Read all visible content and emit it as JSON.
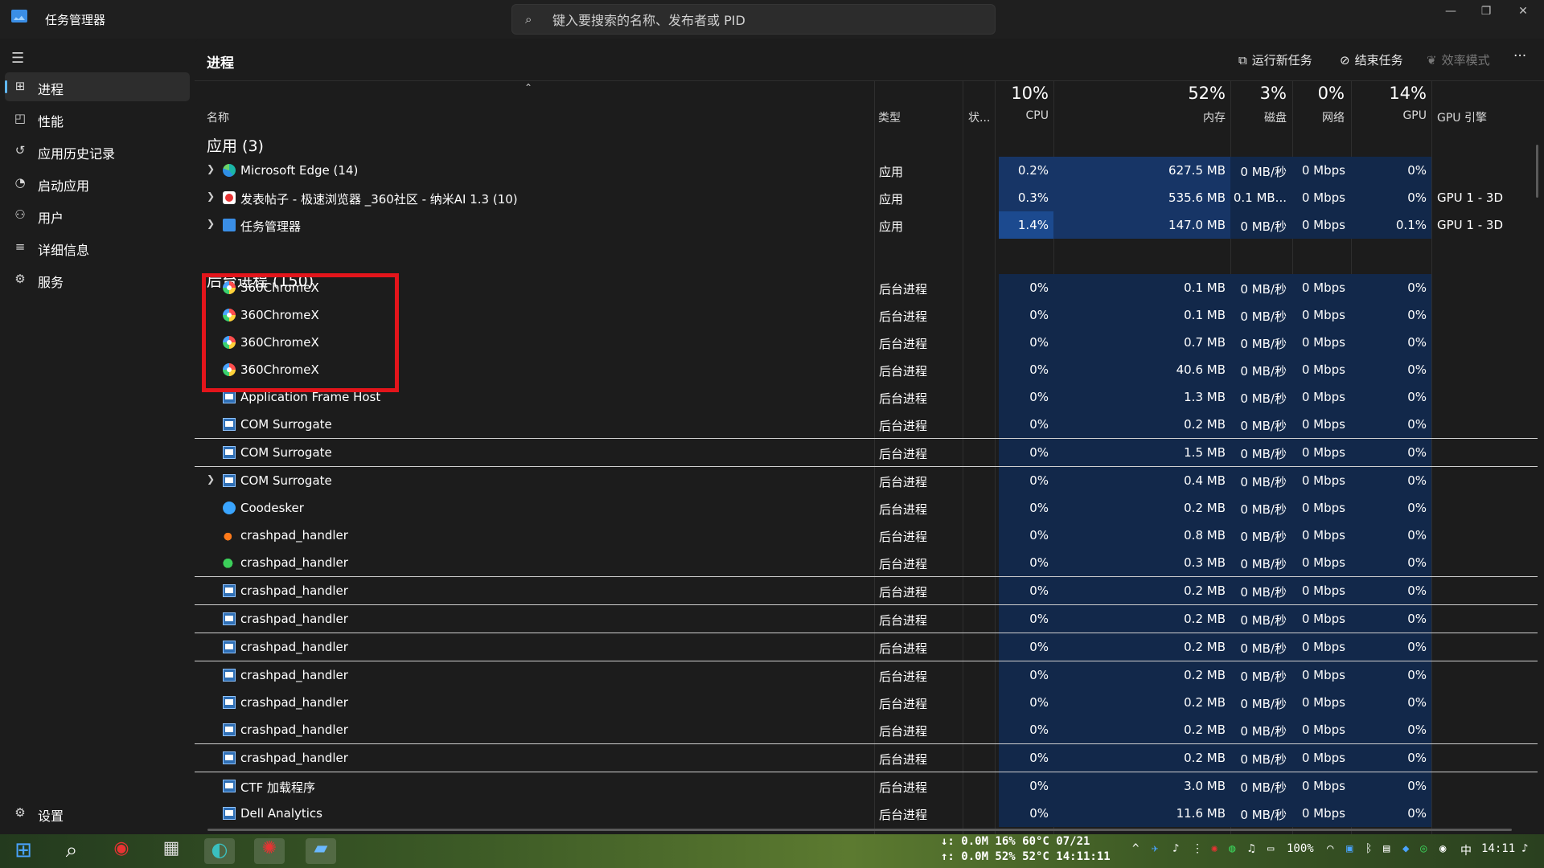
{
  "window": {
    "title": "任务管理器",
    "controls": [
      "—",
      "❐",
      "✕"
    ]
  },
  "search": {
    "placeholder": "键入要搜索的名称、发布者或 PID"
  },
  "sidebar": {
    "items": [
      {
        "label": "进程",
        "icon": "processes-icon",
        "active": true
      },
      {
        "label": "性能",
        "icon": "performance-icon"
      },
      {
        "label": "应用历史记录",
        "icon": "app-history-icon"
      },
      {
        "label": "启动应用",
        "icon": "startup-apps-icon"
      },
      {
        "label": "用户",
        "icon": "users-icon"
      },
      {
        "label": "详细信息",
        "icon": "details-icon"
      },
      {
        "label": "服务",
        "icon": "services-icon"
      }
    ],
    "settings": "设置"
  },
  "toolbar": {
    "page_title": "进程",
    "run_new_task": "运行新任务",
    "end_task": "结束任务",
    "efficiency_mode": "效率模式",
    "more": "···"
  },
  "header": {
    "name": "名称",
    "type": "类型",
    "status": "状...",
    "cpu_pct": "10%",
    "cpu": "CPU",
    "mem_pct": "52%",
    "mem": "内存",
    "disk_pct": "3%",
    "disk": "磁盘",
    "net_pct": "0%",
    "net": "网络",
    "gpu_pct": "14%",
    "gpu": "GPU",
    "gpu_engine": "GPU 引擎"
  },
  "groups": {
    "apps": "应用 (3)",
    "background": "后台进程 (150)"
  },
  "apps": [
    {
      "name": "Microsoft Edge (14)",
      "type": "应用",
      "cpu": "0.2%",
      "mem": "627.5 MB",
      "disk": "0 MB/秒",
      "net": "0 Mbps",
      "gpu": "0%",
      "engine": ""
    },
    {
      "name": "发表帖子 - 极速浏览器 _360社区 - 纳米AI 1.3 (10)",
      "type": "应用",
      "cpu": "0.3%",
      "mem": "535.6 MB",
      "disk": "0.1 MB...",
      "net": "0 Mbps",
      "gpu": "0%",
      "engine": "GPU 1 - 3D"
    },
    {
      "name": "任务管理器",
      "type": "应用",
      "cpu": "1.4%",
      "mem": "147.0 MB",
      "disk": "0 MB/秒",
      "net": "0 Mbps",
      "gpu": "0.1%",
      "engine": "GPU 1 - 3D"
    }
  ],
  "background": [
    {
      "name": "360ChromeX",
      "type": "后台进程",
      "cpu": "0%",
      "mem": "0.1 MB",
      "disk": "0 MB/秒",
      "net": "0 Mbps",
      "gpu": "0%"
    },
    {
      "name": "360ChromeX",
      "type": "后台进程",
      "cpu": "0%",
      "mem": "0.1 MB",
      "disk": "0 MB/秒",
      "net": "0 Mbps",
      "gpu": "0%"
    },
    {
      "name": "360ChromeX",
      "type": "后台进程",
      "cpu": "0%",
      "mem": "0.7 MB",
      "disk": "0 MB/秒",
      "net": "0 Mbps",
      "gpu": "0%"
    },
    {
      "name": "360ChromeX",
      "type": "后台进程",
      "cpu": "0%",
      "mem": "40.6 MB",
      "disk": "0 MB/秒",
      "net": "0 Mbps",
      "gpu": "0%"
    },
    {
      "name": "Application Frame Host",
      "type": "后台进程",
      "cpu": "0%",
      "mem": "1.3 MB",
      "disk": "0 MB/秒",
      "net": "0 Mbps",
      "gpu": "0%"
    },
    {
      "name": "COM Surrogate",
      "type": "后台进程",
      "cpu": "0%",
      "mem": "0.2 MB",
      "disk": "0 MB/秒",
      "net": "0 Mbps",
      "gpu": "0%"
    },
    {
      "name": "COM Surrogate",
      "type": "后台进程",
      "cpu": "0%",
      "mem": "1.5 MB",
      "disk": "0 MB/秒",
      "net": "0 Mbps",
      "gpu": "0%"
    },
    {
      "name": "COM Surrogate",
      "type": "后台进程",
      "cpu": "0%",
      "mem": "0.4 MB",
      "disk": "0 MB/秒",
      "net": "0 Mbps",
      "gpu": "0%"
    },
    {
      "name": "Coodesker",
      "type": "后台进程",
      "cpu": "0%",
      "mem": "0.2 MB",
      "disk": "0 MB/秒",
      "net": "0 Mbps",
      "gpu": "0%"
    },
    {
      "name": "crashpad_handler",
      "type": "后台进程",
      "cpu": "0%",
      "mem": "0.8 MB",
      "disk": "0 MB/秒",
      "net": "0 Mbps",
      "gpu": "0%"
    },
    {
      "name": "crashpad_handler",
      "type": "后台进程",
      "cpu": "0%",
      "mem": "0.3 MB",
      "disk": "0 MB/秒",
      "net": "0 Mbps",
      "gpu": "0%"
    },
    {
      "name": "crashpad_handler",
      "type": "后台进程",
      "cpu": "0%",
      "mem": "0.2 MB",
      "disk": "0 MB/秒",
      "net": "0 Mbps",
      "gpu": "0%"
    },
    {
      "name": "crashpad_handler",
      "type": "后台进程",
      "cpu": "0%",
      "mem": "0.2 MB",
      "disk": "0 MB/秒",
      "net": "0 Mbps",
      "gpu": "0%"
    },
    {
      "name": "crashpad_handler",
      "type": "后台进程",
      "cpu": "0%",
      "mem": "0.2 MB",
      "disk": "0 MB/秒",
      "net": "0 Mbps",
      "gpu": "0%"
    },
    {
      "name": "crashpad_handler",
      "type": "后台进程",
      "cpu": "0%",
      "mem": "0.2 MB",
      "disk": "0 MB/秒",
      "net": "0 Mbps",
      "gpu": "0%"
    },
    {
      "name": "crashpad_handler",
      "type": "后台进程",
      "cpu": "0%",
      "mem": "0.2 MB",
      "disk": "0 MB/秒",
      "net": "0 Mbps",
      "gpu": "0%"
    },
    {
      "name": "crashpad_handler",
      "type": "后台进程",
      "cpu": "0%",
      "mem": "0.2 MB",
      "disk": "0 MB/秒",
      "net": "0 Mbps",
      "gpu": "0%"
    },
    {
      "name": "crashpad_handler",
      "type": "后台进程",
      "cpu": "0%",
      "mem": "0.2 MB",
      "disk": "0 MB/秒",
      "net": "0 Mbps",
      "gpu": "0%"
    },
    {
      "name": "CTF 加载程序",
      "type": "后台进程",
      "cpu": "0%",
      "mem": "3.0 MB",
      "disk": "0 MB/秒",
      "net": "0 Mbps",
      "gpu": "0%"
    },
    {
      "name": "Dell Analytics",
      "type": "后台进程",
      "cpu": "0%",
      "mem": "11.6 MB",
      "disk": "0 MB/秒",
      "net": "0 Mbps",
      "gpu": "0%"
    }
  ],
  "colors": {
    "heat_dark": "#12284a",
    "heat_mid": "#173566",
    "heat_strong": "#1c4a8f",
    "highlight": "#e3151b",
    "accent": "#60b8ff"
  },
  "taskbar": {
    "monitor_line1": "↓: 0.0M 16% 60°C 07/21",
    "monitor_line2": "↑: 0.0M 52% 52°C 14:11:11",
    "battery": "100%",
    "ime": "中",
    "time": "14:11"
  }
}
